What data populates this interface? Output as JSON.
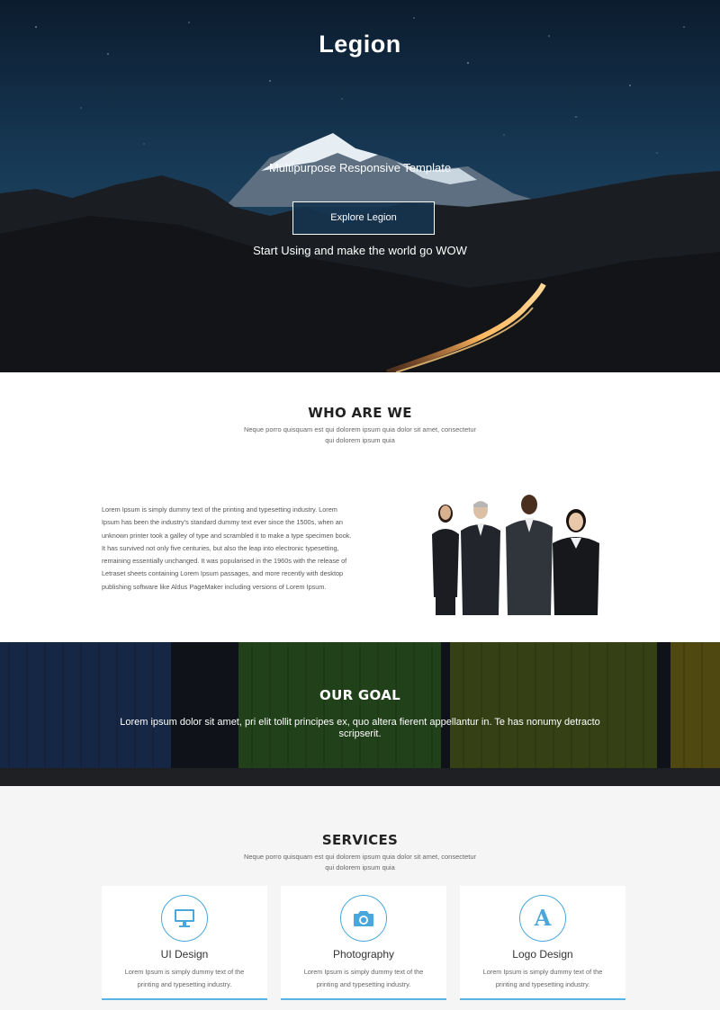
{
  "hero": {
    "title": "Legion",
    "subtitle": "Multipurpose Responsive Template",
    "cta_label": "Explore Legion",
    "tagline": "Start Using and make the world go WOW"
  },
  "who": {
    "title": "WHO ARE WE",
    "subtitle": "Neque porro quisquam est qui dolorem ipsum quia dolor sit amet, consectetur qui dolorem ipsum quia",
    "paragraph": "Lorem Ipsum is simply dummy text of the printing and typesetting industry. Lorem Ipsum has been the industry's standard dummy text ever since the 1500s, when an unknown printer took a galley of type and scrambled it to make a type specimen book. It has survived not only five centuries, but also the leap into electronic typesetting, remaining essentially unchanged. It was popularised in the 1960s with the release of Letraset sheets containing Lorem Ipsum passages, and more recently with desktop publishing software like Aldus PageMaker including versions of Lorem Ipsum."
  },
  "goal": {
    "title": "OUR GOAL",
    "text": "Lorem ipsum dolor sit amet, pri elit tollit principes ex, quo altera fierent appellantur in. Te has nonumy detracto scripserit."
  },
  "services": {
    "title": "SERVICES",
    "subtitle": "Neque porro quisquam est qui dolorem ipsum quia dolor sit amet, consectetur qui dolorem ipsum quia",
    "items": [
      {
        "title": "UI Design",
        "text": "Lorem Ipsum is simply dummy text of the printing and typesetting industry.",
        "icon": "monitor-icon"
      },
      {
        "title": "Photography",
        "text": "Lorem Ipsum is simply dummy text of the printing and typesetting industry.",
        "icon": "camera-icon"
      },
      {
        "title": "Logo Design",
        "text": "Lorem Ipsum is simply dummy text of the printing and typesetting industry.",
        "icon": "letter-a-icon",
        "glyph": "A"
      }
    ]
  },
  "colors": {
    "accent": "#4aa7dc",
    "hero_dark": "#0b1a2b",
    "section_bg": "#f5f5f5"
  }
}
